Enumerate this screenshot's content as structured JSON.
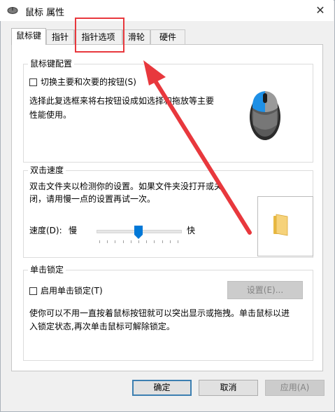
{
  "window": {
    "title": "鼠标 属性",
    "close_glyph": "✕"
  },
  "tabs": [
    {
      "label": "鼠标键",
      "active": true
    },
    {
      "label": "指针",
      "active": false
    },
    {
      "label": "指针选项",
      "active": false
    },
    {
      "label": "滑轮",
      "active": false
    },
    {
      "label": "硬件",
      "active": false
    }
  ],
  "button_config": {
    "group_title": "鼠标键配置",
    "switch_checkbox_label": "切换主要和次要的按钮(S)",
    "switch_checked": false,
    "description_line1": "选择此复选框来将右按钮设成如选择和拖放等主要",
    "description_line2": "性能使用。"
  },
  "double_click": {
    "group_title": "双击速度",
    "description_line1": "双击文件夹以检测你的设置。如果文件夹没打开或关",
    "description_line2": "闭，请用慢一点的设置再试一次。",
    "speed_label": "速度(D):",
    "slow_label": "慢",
    "fast_label": "快",
    "speed_value": 0.5
  },
  "click_lock": {
    "group_title": "单击锁定",
    "enable_checkbox_label": "启用单击锁定(T)",
    "enable_checked": false,
    "settings_button": "设置(E)...",
    "description_line1": "使你可以不用一直按着鼠标按钮就可以突出显示或拖拽。单击鼠标以进",
    "description_line2": "入锁定状态,再次单击鼠标可解除锁定。"
  },
  "footer": {
    "ok_label": "确定",
    "cancel_label": "取消",
    "apply_label": "应用(A)"
  },
  "annotation": {
    "color": "#e8383d"
  },
  "colors": {
    "accent": "#0078d7",
    "folder": "#f6d27a"
  }
}
